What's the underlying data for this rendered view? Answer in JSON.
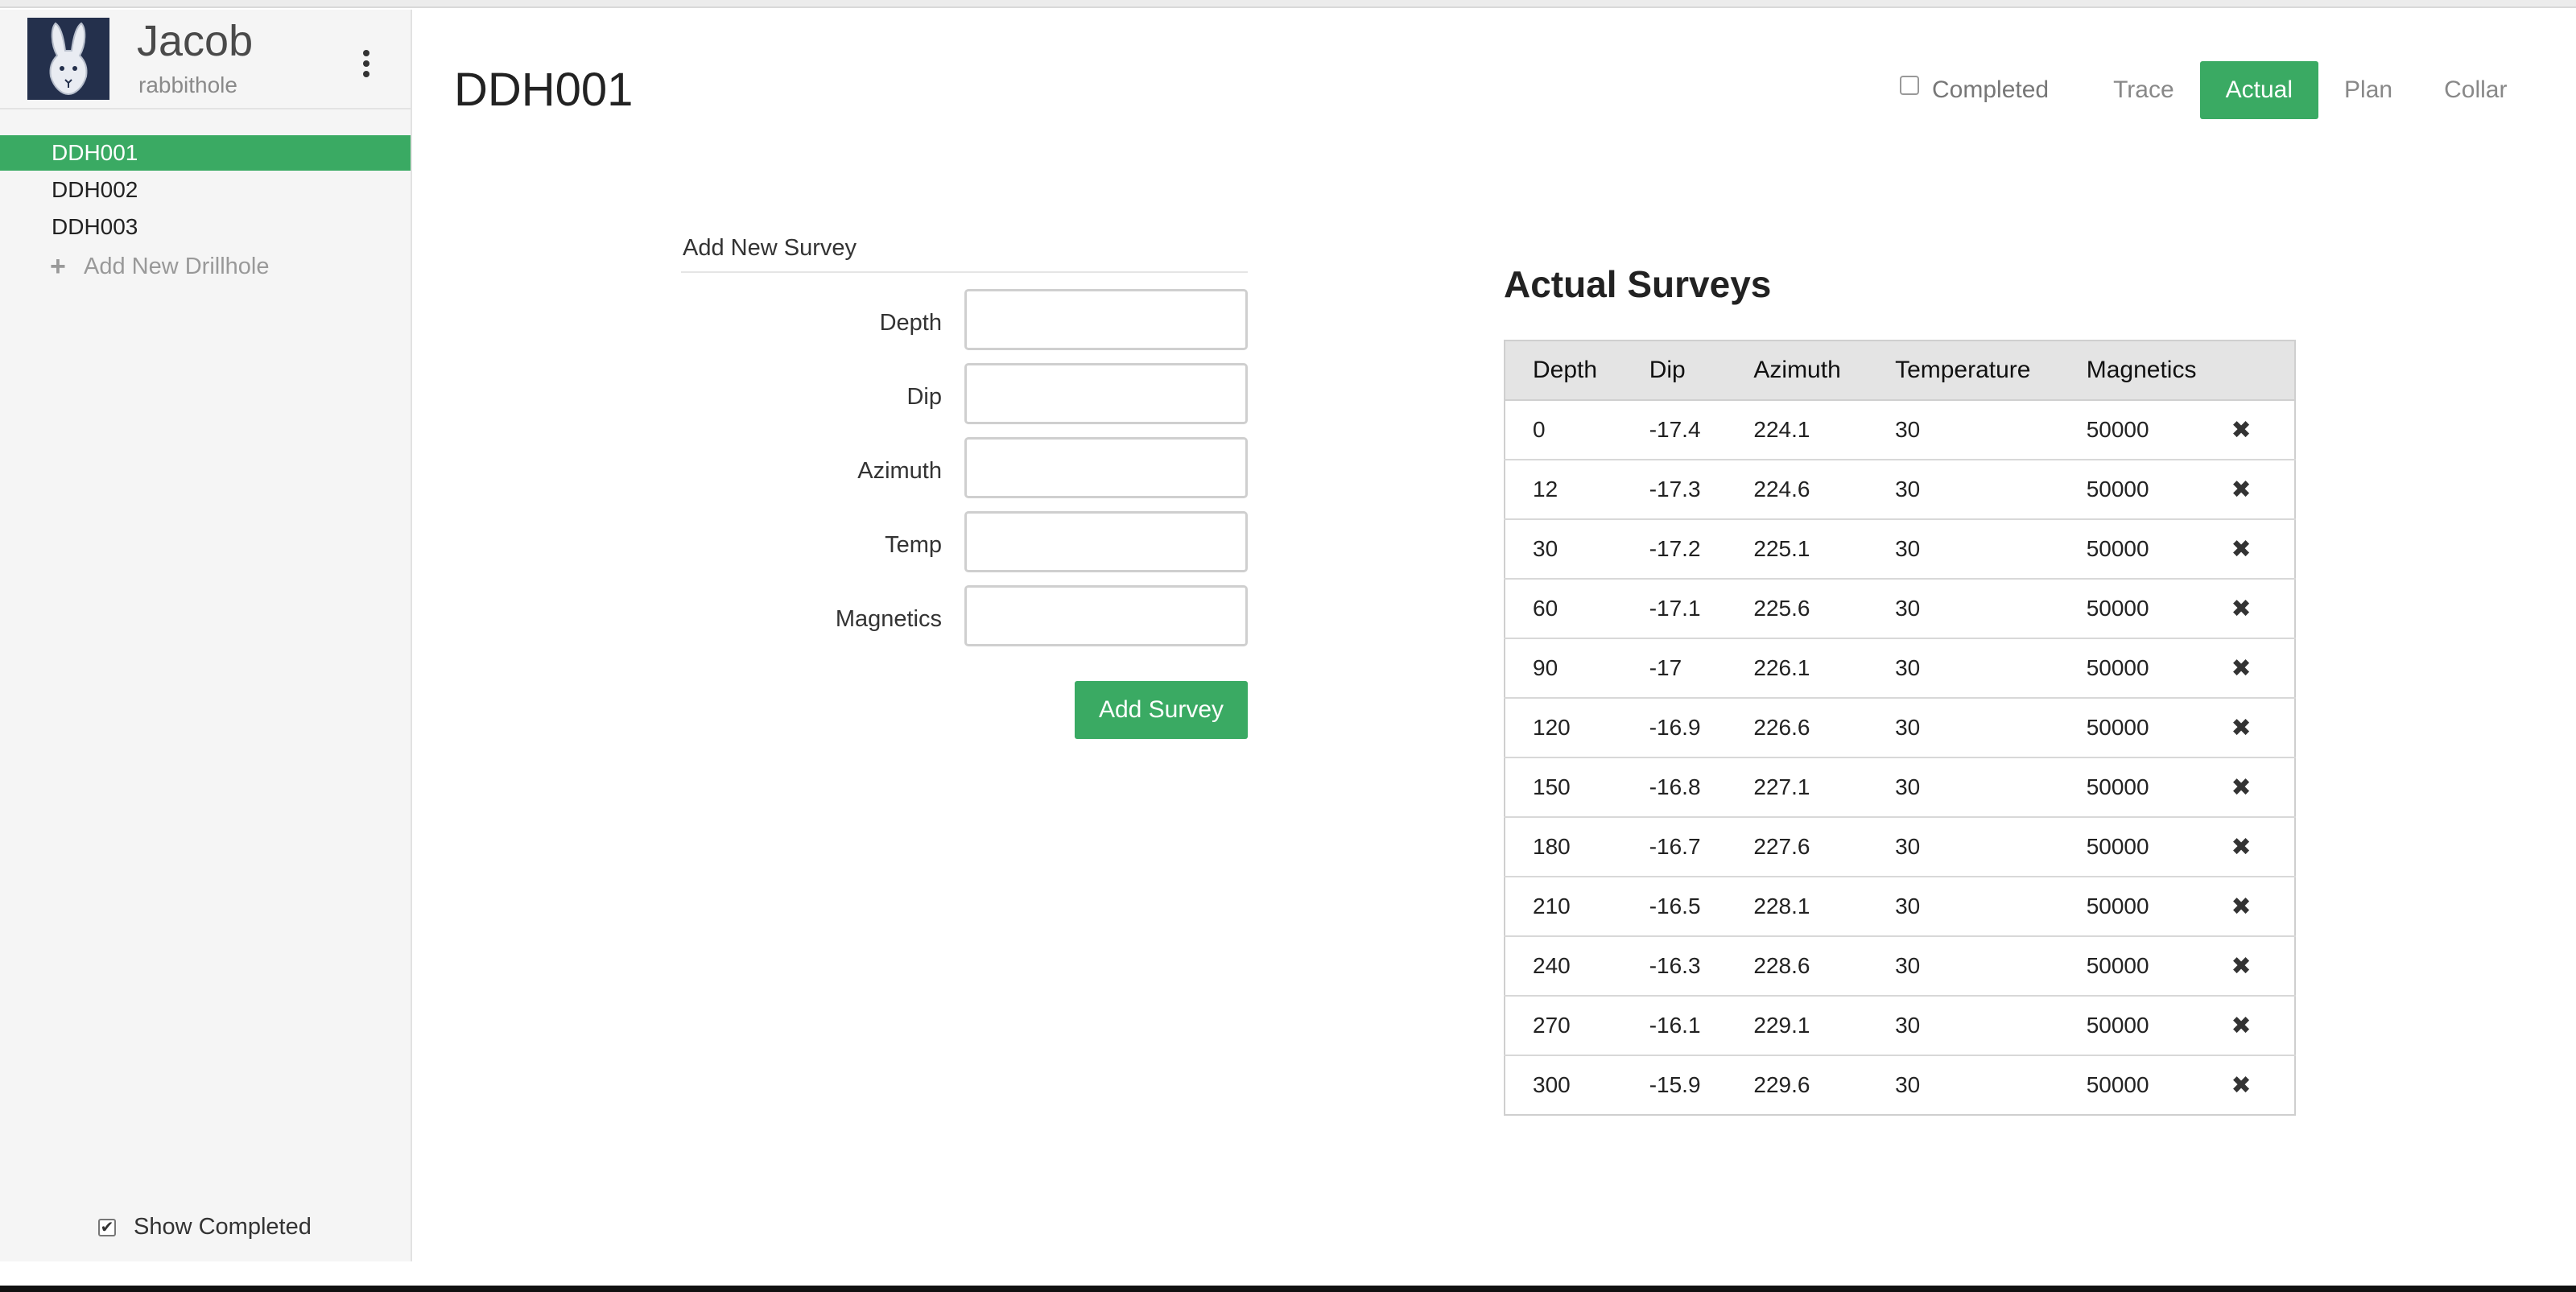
{
  "user": {
    "name": "Jacob",
    "handle": "rabbithole"
  },
  "sidebar": {
    "drillholes": [
      {
        "label": "DDH001",
        "active": true
      },
      {
        "label": "DDH002",
        "active": false
      },
      {
        "label": "DDH003",
        "active": false
      }
    ],
    "add_label": "Add New Drillhole",
    "show_completed_label": "Show Completed",
    "show_completed_checked": true
  },
  "header": {
    "title": "DDH001",
    "completed_label": "Completed",
    "tabs": [
      {
        "label": "Trace",
        "active": false
      },
      {
        "label": "Actual",
        "active": true
      },
      {
        "label": "Plan",
        "active": false
      },
      {
        "label": "Collar",
        "active": false
      }
    ]
  },
  "form": {
    "title": "Add New Survey",
    "fields": [
      {
        "label": "Depth",
        "value": ""
      },
      {
        "label": "Dip",
        "value": ""
      },
      {
        "label": "Azimuth",
        "value": ""
      },
      {
        "label": "Temp",
        "value": ""
      },
      {
        "label": "Magnetics",
        "value": ""
      }
    ],
    "submit_label": "Add Survey"
  },
  "surveys": {
    "title": "Actual Surveys",
    "columns": [
      "Depth",
      "Dip",
      "Azimuth",
      "Temperature",
      "Magnetics"
    ],
    "rows": [
      [
        "0",
        "-17.4",
        "224.1",
        "30",
        "50000"
      ],
      [
        "12",
        "-17.3",
        "224.6",
        "30",
        "50000"
      ],
      [
        "30",
        "-17.2",
        "225.1",
        "30",
        "50000"
      ],
      [
        "60",
        "-17.1",
        "225.6",
        "30",
        "50000"
      ],
      [
        "90",
        "-17",
        "226.1",
        "30",
        "50000"
      ],
      [
        "120",
        "-16.9",
        "226.6",
        "30",
        "50000"
      ],
      [
        "150",
        "-16.8",
        "227.1",
        "30",
        "50000"
      ],
      [
        "180",
        "-16.7",
        "227.6",
        "30",
        "50000"
      ],
      [
        "210",
        "-16.5",
        "228.1",
        "30",
        "50000"
      ],
      [
        "240",
        "-16.3",
        "228.6",
        "30",
        "50000"
      ],
      [
        "270",
        "-16.1",
        "229.1",
        "30",
        "50000"
      ],
      [
        "300",
        "-15.9",
        "229.6",
        "30",
        "50000"
      ]
    ],
    "delete_icon": "close-icon"
  },
  "colors": {
    "accent": "#3aaa63",
    "avatar_bg": "#24304c"
  }
}
